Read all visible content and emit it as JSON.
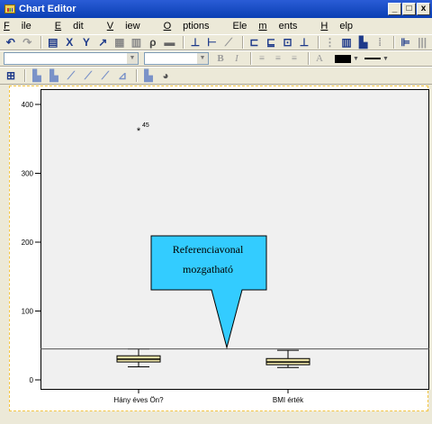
{
  "window": {
    "title": "Chart Editor",
    "controls": {
      "minimize": "_",
      "maximize": "□",
      "close": "x"
    }
  },
  "menubar": {
    "items": [
      {
        "label": "File",
        "access": "F",
        "rest": "ile"
      },
      {
        "label": "Edit",
        "access": "E",
        "rest": "dit"
      },
      {
        "label": "View",
        "access": "V",
        "rest": "iew"
      },
      {
        "label": "Options",
        "access": "O",
        "rest": "ptions"
      },
      {
        "label": "Elements",
        "access": "m",
        "pre": "Ele",
        "rest": "ents"
      },
      {
        "label": "Help",
        "access": "H",
        "rest": "elp"
      }
    ]
  },
  "toolbar": {
    "x_label": "X",
    "y_label": "Y",
    "bold_label": "B",
    "italic_label": "I",
    "text_a_label": "A"
  },
  "chart_data": {
    "type": "boxplot",
    "title": "",
    "xlabel": "",
    "ylabel": "",
    "ylim": [
      0,
      400
    ],
    "yticks": [
      0,
      100,
      200,
      300,
      400
    ],
    "categories": [
      "Hány éves Ön?",
      "BMI érték"
    ],
    "boxes": [
      {
        "category": "Hány éves Ön?",
        "whisker_low": 19,
        "q1": 26,
        "median": 30,
        "q3": 35,
        "whisker_high": 45
      },
      {
        "category": "BMI érték",
        "whisker_low": 18,
        "q1": 22,
        "median": 26,
        "q3": 31,
        "whisker_high": 43
      }
    ],
    "outliers": [
      {
        "category": "Hány éves Ön?",
        "value": 362,
        "label": "45",
        "marker": "*"
      }
    ],
    "reference_line": {
      "value": 45
    },
    "colors": {
      "box_fill": "#e8dfa4",
      "plot_bg": "#f0f0f0",
      "callout_fill": "#33ccff"
    }
  },
  "callout": {
    "line1": "Referenciavonal",
    "line2": "mozgatható"
  }
}
